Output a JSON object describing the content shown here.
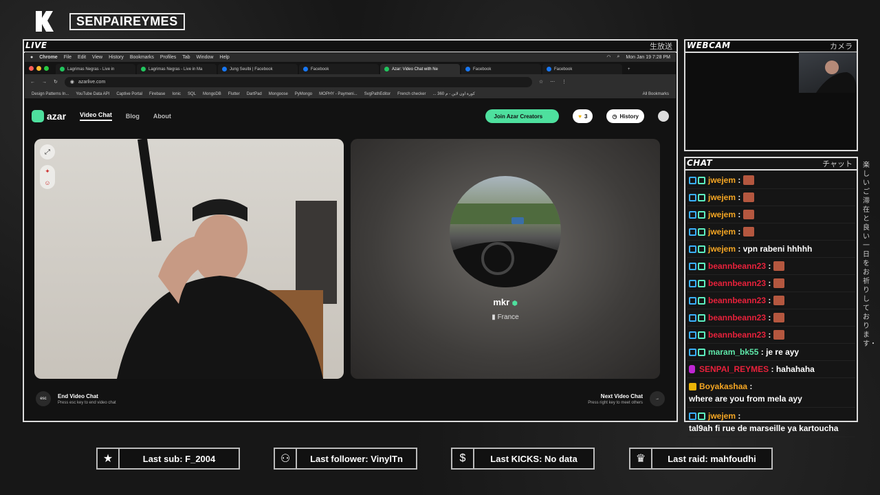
{
  "channel": "SENPAIREYMES",
  "overlay": {
    "live_label": "LIVE",
    "live_jp": "生放送",
    "webcam_label": "WEBCAM",
    "webcam_jp": "カメラ",
    "chat_label": "CHAT",
    "chat_jp": "チャット",
    "side_jp": "楽しいご滞在と良い一日をお祈りしております・"
  },
  "mac_menu": {
    "app": "Chrome",
    "items": [
      "File",
      "Edit",
      "View",
      "History",
      "Bookmarks",
      "Profiles",
      "Tab",
      "Window",
      "Help"
    ],
    "clock": "Mon Jan 19  7:28 PM"
  },
  "tabs": [
    {
      "title": "Lagrimas Negras - Live in",
      "active": false
    },
    {
      "title": "Lagrimas Negras - Live in Ma",
      "active": false
    },
    {
      "title": "Jung Seulbi | Facebook",
      "active": false
    },
    {
      "title": "Facebook",
      "active": false
    },
    {
      "title": "Azar: Video Chat with Ne",
      "active": true
    },
    {
      "title": "Facebook",
      "active": false
    },
    {
      "title": "Facebook",
      "active": false
    }
  ],
  "url": "azarlive.com",
  "bookmarks": [
    "Design Patterns In...",
    "YouTube Data API",
    "Captive Portal",
    "Firebase",
    "Ionic",
    "SQL",
    "MongoDB",
    "Flutter",
    "DartPad",
    "Mongoose",
    "PyMongo",
    "MOPHY - Paymeni...",
    "SvgPathEditor",
    "French checker",
    "... 360 كورة اون لاين - م",
    "All Bookmarks"
  ],
  "azar": {
    "brand": "azar",
    "nav": [
      "Video Chat",
      "Blog",
      "About"
    ],
    "creators_button": "Join Azar Creators",
    "gems": "3",
    "history": "History"
  },
  "peer": {
    "name": "mkr",
    "country": "France"
  },
  "controls": {
    "end_key": "esc",
    "end_title": "End Video Chat",
    "end_sub": "Press esc key to end video chat",
    "next_title": "Next Video Chat",
    "next_sub": "Press right key to meet others"
  },
  "chat": [
    {
      "user": "jwejem",
      "color": "#f5a623",
      "text": "",
      "emote": true
    },
    {
      "user": "jwejem",
      "color": "#f5a623",
      "text": "",
      "emote": true
    },
    {
      "user": "jwejem",
      "color": "#f5a623",
      "text": "",
      "emote": true
    },
    {
      "user": "jwejem",
      "color": "#f5a623",
      "text": "",
      "emote": true
    },
    {
      "user": "jwejem",
      "color": "#f5a623",
      "text": "vpn rabeni hhhhh",
      "emote": false
    },
    {
      "user": "beannbeann23",
      "color": "#e8213b",
      "text": "",
      "emote": true
    },
    {
      "user": "beannbeann23",
      "color": "#e8213b",
      "text": "",
      "emote": true
    },
    {
      "user": "beannbeann23",
      "color": "#e8213b",
      "text": "",
      "emote": true
    },
    {
      "user": "beannbeann23",
      "color": "#e8213b",
      "text": "",
      "emote": true
    },
    {
      "user": "beannbeann23",
      "color": "#e8213b",
      "text": "",
      "emote": true
    },
    {
      "user": "maram_bk55",
      "color": "#5ee6a8",
      "text": "je re ayy",
      "emote": false
    },
    {
      "user": "SENPAI_REYMES",
      "color": "#e8213b",
      "text": "hahahaha",
      "emote": false,
      "mod": true
    },
    {
      "user": "Boyakashaa",
      "color": "#f5a623",
      "text": "where are you from mela ayy",
      "emote": false,
      "crown": true
    },
    {
      "user": "jwejem",
      "color": "#f5a623",
      "text": "tal9ah fi rue de marseille ya kartoucha",
      "emote": false
    }
  ],
  "stats": {
    "sub": "Last sub: F_2004",
    "follower": "Last follower: VinylTn",
    "kicks": "Last KICKS: No data",
    "raid": "Last raid: mahfoudhi"
  },
  "icons": {
    "logo": "k-logo-icon",
    "sub": "star-icon",
    "follower": "add-user-icon",
    "kicks": "dollar-icon",
    "raid": "crown-icon"
  }
}
